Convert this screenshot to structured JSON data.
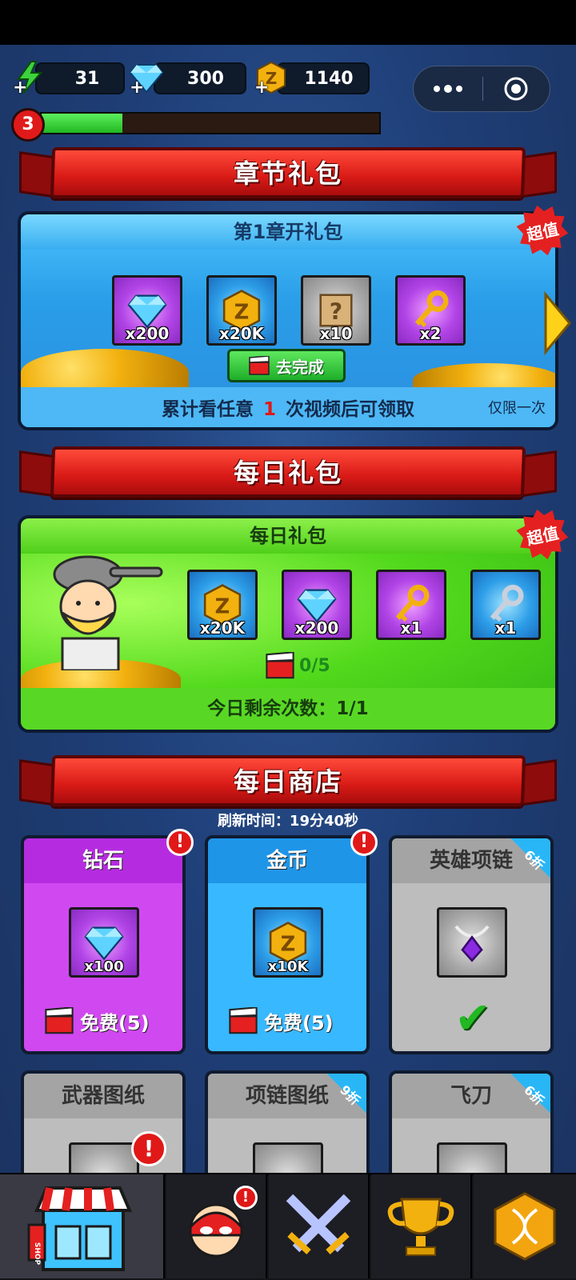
{
  "resources": {
    "energy": "31",
    "gems": "300",
    "coins": "1140",
    "plus": "+"
  },
  "player": {
    "level": "3",
    "xp_progress": 0.24
  },
  "chapter_section": {
    "title": "章节礼包",
    "pack_title": "第1章开礼包",
    "badge": "超值",
    "items": [
      {
        "icon": "diamond-icon",
        "count": "x200"
      },
      {
        "icon": "gold-coin-icon",
        "count": "x20K"
      },
      {
        "icon": "mystery-scroll-icon",
        "count": "x10"
      },
      {
        "icon": "gold-key-icon",
        "count": "x2"
      }
    ],
    "button_label": "去完成",
    "requirement_prefix": "累计看任意",
    "requirement_number": "1",
    "requirement_suffix": "次视频后可领取",
    "limit_note": "仅限一次"
  },
  "daily_section": {
    "title": "每日礼包",
    "pack_title": "每日礼包",
    "badge": "超值",
    "items": [
      {
        "icon": "gold-coin-icon",
        "count": "x20K"
      },
      {
        "icon": "diamond-icon",
        "count": "x200"
      },
      {
        "icon": "gold-key-icon",
        "count": "x1"
      },
      {
        "icon": "silver-key-icon",
        "count": "x1"
      }
    ],
    "video_progress": "0/5",
    "remaining_text": "今日剩余次数：1/1"
  },
  "shop_section": {
    "title": "每日商店",
    "refresh_text": "刷新时间：19分40秒",
    "cards": [
      {
        "name": "钻石",
        "count": "x100",
        "action": "免费(5)",
        "alert": "!"
      },
      {
        "name": "金币",
        "count": "x10K",
        "action": "免费(5)",
        "alert": "!"
      },
      {
        "name": "英雄项链",
        "discount": "6折",
        "status": "✔"
      },
      {
        "name": "武器图纸",
        "alert": "!"
      },
      {
        "name": "项链图纸",
        "discount": "9折"
      },
      {
        "name": "飞刀",
        "discount": "6折"
      }
    ]
  },
  "bottom_nav": {
    "shop_label": "SHOP",
    "hero_alert": "!",
    "tabs": [
      "shop-tab",
      "hero-tab",
      "battle-tab",
      "trophy-tab",
      "dna-tab"
    ]
  }
}
